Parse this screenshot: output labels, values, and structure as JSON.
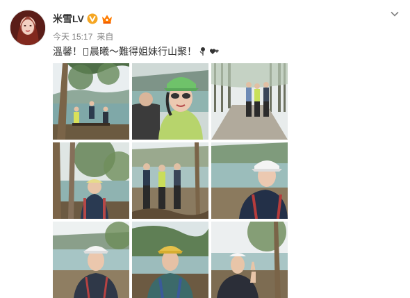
{
  "user": {
    "name": "米雪LV",
    "verified_icon": "verified-v-icon",
    "vip_icon": "vip-crown-icon"
  },
  "meta": {
    "time": "今天 15:17",
    "source": "来自"
  },
  "post": {
    "text_before": "溫馨！",
    "text_middle": "晨曦～難得姐妹行山聚！",
    "emojis": [
      "unsupported-char-box",
      "rose-icon",
      "hearts-icon"
    ]
  },
  "photos": [
    {
      "scene": "trees-lake-group-of-three"
    },
    {
      "scene": "selfie-green-cap-sunglasses"
    },
    {
      "scene": "three-women-forest-path"
    },
    {
      "scene": "woman-with-tree-and-lake"
    },
    {
      "scene": "three-women-reservoir-roots"
    },
    {
      "scene": "woman-white-cap-reservoir"
    },
    {
      "scene": "woman-white-cap-lakeside"
    },
    {
      "scene": "woman-yellow-cap-hill"
    },
    {
      "scene": "woman-peace-sign-tree"
    }
  ],
  "colors": {
    "username": "#333333",
    "meta": "#808080",
    "verified": "#f5a623",
    "vip": "#ff7c00"
  }
}
